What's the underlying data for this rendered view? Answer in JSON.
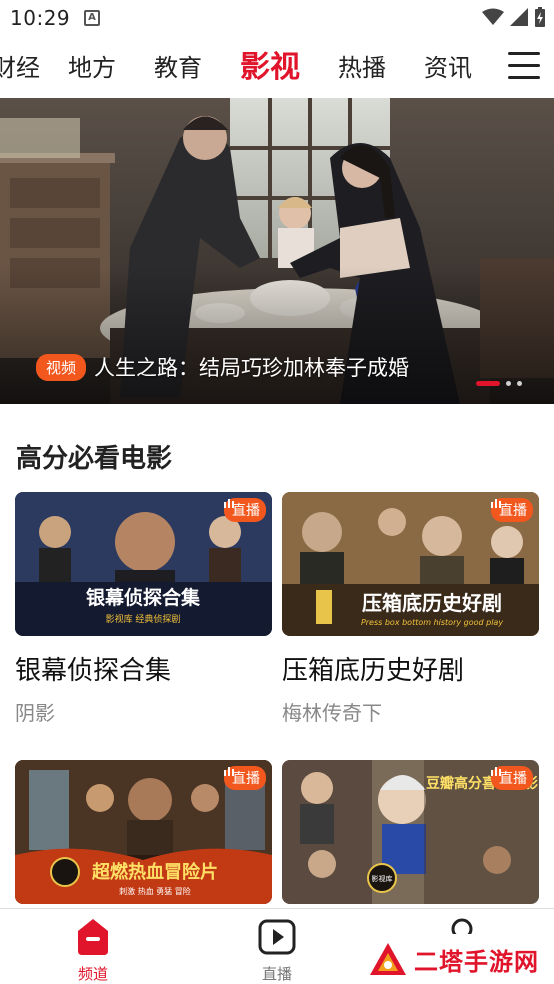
{
  "status_bar": {
    "time": "10:29",
    "notif_icon": "A"
  },
  "channels": [
    {
      "label": "财经"
    },
    {
      "label": "地方"
    },
    {
      "label": "教育"
    },
    {
      "label": "影视",
      "active": true
    },
    {
      "label": "热播"
    },
    {
      "label": "资讯"
    }
  ],
  "hero": {
    "tag": "视频",
    "title": "人生之路：结局巧珍加林奉子成婚",
    "slide_count": 3,
    "active_slide": 1
  },
  "section": {
    "title": "高分必看电影",
    "cards": [
      {
        "title": "银幕侦探合集",
        "subtitle": "阴影",
        "badge": "直播",
        "poster_text": "银幕侦探合集",
        "poster_sub": "影视库 经典侦探剧"
      },
      {
        "title": "压箱底历史好剧",
        "subtitle": "梅林传奇下",
        "badge": "直播",
        "poster_text": "压箱底历史好剧",
        "poster_sub": "Press box bottom history good play"
      },
      {
        "title": "",
        "subtitle": "",
        "badge": "直播",
        "poster_text": "超燃热血冒险片",
        "poster_sub": "刺激 热血 勇猛 冒险"
      },
      {
        "title": "",
        "subtitle": "",
        "badge": "直播",
        "poster_text": "豆瓣高分喜剧电影",
        "poster_sub": "影视库"
      }
    ]
  },
  "bottom_nav": [
    {
      "label": "频道",
      "icon": "channel-icon",
      "active": true
    },
    {
      "label": "直播",
      "icon": "play-icon",
      "active": false
    },
    {
      "label": "",
      "icon": "profile-icon",
      "active": false
    }
  ],
  "watermark": {
    "text": "二塔手游网"
  },
  "colors": {
    "accent": "#e0142a",
    "tag": "#f2581e"
  }
}
